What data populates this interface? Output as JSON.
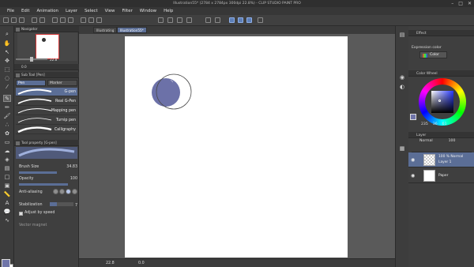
{
  "window": {
    "title": "Illustration55* (2784 x 2784px 300dpi 22.8%) - CLIP STUDIO PAINT PRO",
    "minimize": "–",
    "maximize": "□",
    "close": "✕"
  },
  "menu": [
    "File",
    "Edit",
    "Animation",
    "Layer",
    "Select",
    "View",
    "Filter",
    "Window",
    "Help"
  ],
  "canvas_tabs": [
    {
      "label": "Illustrating"
    },
    {
      "label": "Illustration55*"
    }
  ],
  "navigator": {
    "title": "Navigator",
    "zoom": "22.8",
    "rotation": "0.0"
  },
  "subtool": {
    "title": "Sub Tool [Pen]",
    "tabs": [
      "Pen",
      "Marker"
    ],
    "brushes": [
      "G-pen",
      "Real G-Pen",
      "Mapping pen",
      "Turnip pen",
      "Calligraphy"
    ]
  },
  "tool_property": {
    "title": "Tool property [G-pen]",
    "brush_size_label": "Brush Size",
    "brush_size_value": "34.83",
    "opacity_label": "Opacity",
    "opacity_value": "100",
    "antialias_label": "Anti-aliasing",
    "stabilization_label": "Stabilization",
    "stabilization_value": "7",
    "adjust_label": "Adjust by speed",
    "vector_label": "Vector magnet"
  },
  "colors": {
    "main": "#6f74a8",
    "sub": "#ffffff",
    "accent": "#5b6e96",
    "circle_fill": "#6c71a8",
    "circle_stroke": "#4a4a4a"
  },
  "effect": {
    "title": "Effect",
    "label": "Expression color",
    "value": "Color"
  },
  "color_wheel": {
    "title": "Color Wheel",
    "h": "235",
    "s": "36",
    "v": "61"
  },
  "layers": {
    "title": "Layer",
    "blend": "Normal",
    "opacity": "100",
    "rows": [
      {
        "line1": "100 % Normal",
        "line2": "Layer 1",
        "active": true
      },
      {
        "line1": "Paper",
        "line2": "",
        "active": false
      }
    ]
  },
  "status": {
    "zoom": "22.8",
    "rotation": "0.0"
  }
}
